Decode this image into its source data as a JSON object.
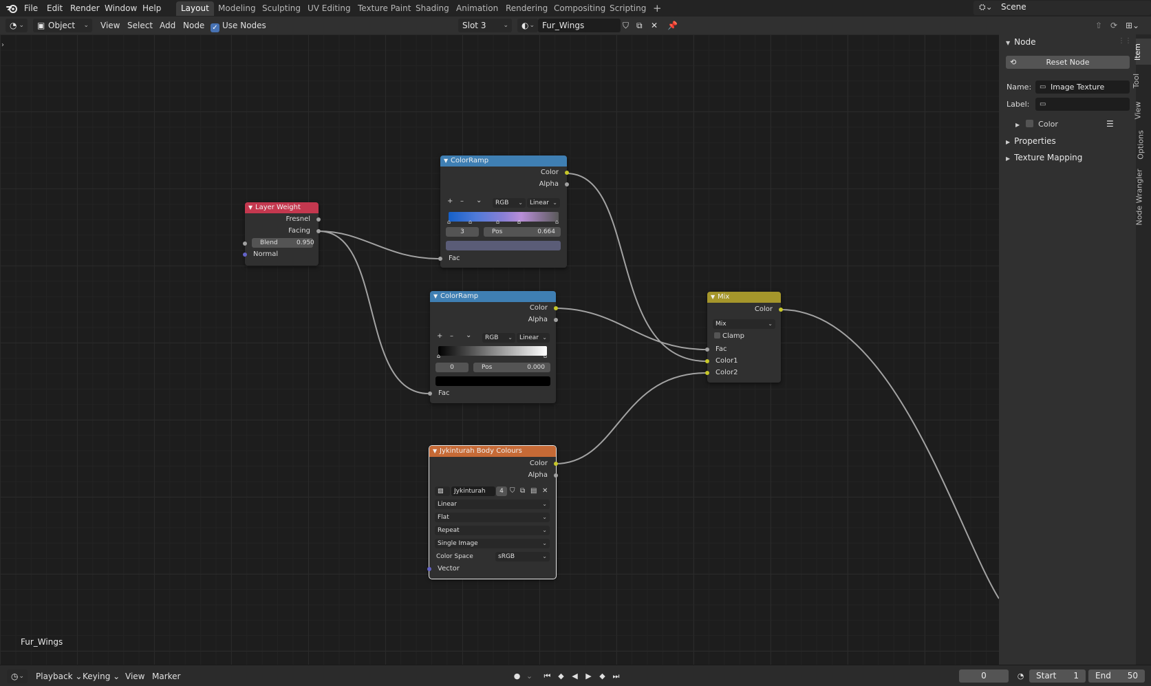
{
  "menubar": {
    "items": [
      "File",
      "Edit",
      "Render",
      "Window",
      "Help"
    ],
    "workspaces": [
      "Layout",
      "Modeling",
      "Sculpting",
      "UV Editing",
      "Texture Paint",
      "Shading",
      "Animation",
      "Rendering",
      "Compositing",
      "Scripting"
    ],
    "active_workspace": "Layout",
    "add_tab": "+",
    "scene": "Scene"
  },
  "header": {
    "mode": "Object",
    "menus": [
      "View",
      "Select",
      "Add",
      "Node"
    ],
    "use_nodes_label": "Use Nodes",
    "use_nodes_checked": true,
    "slot": "Slot 3",
    "material": "Fur_Wings"
  },
  "nodes": {
    "layer_weight": {
      "title": "Layer Weight",
      "outputs": [
        "Fresnel",
        "Facing"
      ],
      "blend_label": "Blend",
      "blend_value": "0.950",
      "inputs": [
        "Normal"
      ]
    },
    "colorramp1": {
      "title": "ColorRamp",
      "outputs": [
        "Color",
        "Alpha"
      ],
      "mode": "RGB",
      "interp": "Linear",
      "index": "3",
      "pos_label": "Pos",
      "pos_value": "0.664",
      "input": "Fac"
    },
    "colorramp2": {
      "title": "ColorRamp",
      "outputs": [
        "Color",
        "Alpha"
      ],
      "mode": "RGB",
      "interp": "Linear",
      "index": "0",
      "pos_label": "Pos",
      "pos_value": "0.000",
      "input": "Fac"
    },
    "mix": {
      "title": "Mix",
      "output": "Color",
      "blend_type": "Mix",
      "clamp_label": "Clamp",
      "inputs": [
        "Fac",
        "Color1",
        "Color2"
      ]
    },
    "image": {
      "title": "Jykinturah Body Colours",
      "outputs": [
        "Color",
        "Alpha"
      ],
      "image_name": "Jykinturah B...",
      "users": "4",
      "interpolation": "Linear",
      "projection": "Flat",
      "extension": "Repeat",
      "source": "Single Image",
      "colorspace_label": "Color Space",
      "colorspace": "sRGB",
      "input": "Vector"
    }
  },
  "tree_name": "Fur_Wings",
  "sidebar": {
    "panel_title": "Node",
    "reset_button": "Reset Node",
    "name_label": "Name:",
    "name_value": "Image Texture",
    "label_label": "Label:",
    "label_value": "",
    "color_label": "Color",
    "properties": "Properties",
    "texture_mapping": "Texture Mapping",
    "tabs": [
      "Item",
      "Tool",
      "View",
      "Options",
      "Node Wrangler"
    ]
  },
  "timeline": {
    "menus": [
      "Playback",
      "Keying",
      "View",
      "Marker"
    ],
    "current_frame": "0",
    "start_label": "Start",
    "start_value": "1",
    "end_label": "End",
    "end_value": "50"
  },
  "colors": {
    "accent": "#4772b3",
    "colorramp_header": "#3f7fb3",
    "layer_weight_header": "#c4384f",
    "mix_header": "#a5962b",
    "image_header": "#c66a36"
  }
}
